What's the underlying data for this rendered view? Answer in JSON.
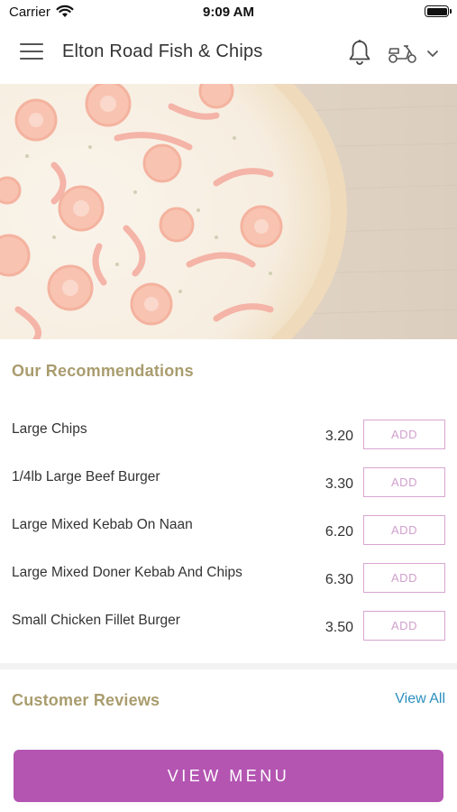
{
  "status_bar": {
    "carrier": "Carrier",
    "time": "9:09 AM"
  },
  "header": {
    "title": "Elton Road Fish & Chips",
    "icons": [
      "menu-icon",
      "bell-icon",
      "scooter-icon",
      "chevron-down-icon"
    ]
  },
  "hero": {
    "image": "pizza-image"
  },
  "recommendations": {
    "title": "Our Recommendations",
    "add_label": "ADD",
    "items": [
      {
        "name": "Large Chips",
        "price": "3.20"
      },
      {
        "name": "1/4lb Large Beef Burger",
        "price": "3.30"
      },
      {
        "name": "Large Mixed Kebab On Naan",
        "price": "6.20"
      },
      {
        "name": "Large Mixed Doner Kebab And Chips",
        "price": "6.30"
      },
      {
        "name": "Small Chicken Fillet Burger",
        "price": "3.50"
      }
    ]
  },
  "reviews": {
    "title": "Customer Reviews",
    "view_all": "View All"
  },
  "footer": {
    "view_menu": "VIEW MENU"
  },
  "colors": {
    "accent": "#b455b2",
    "section_title": "#a99c6e",
    "link": "#2a8fbf",
    "add_border": "#d9a5d2"
  }
}
